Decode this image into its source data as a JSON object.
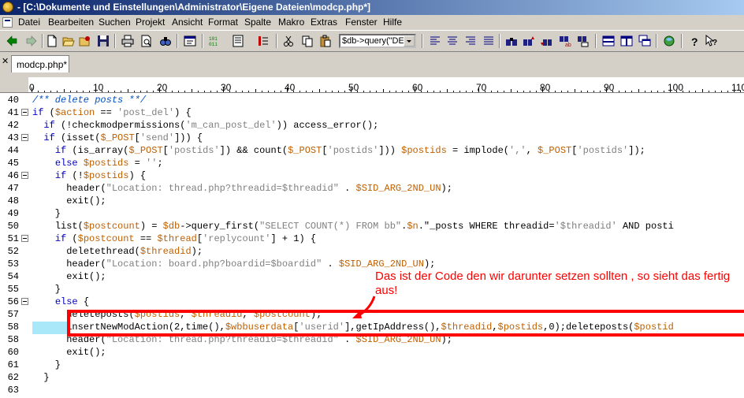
{
  "window": {
    "title": "- [C:\\Dokumente und Einstellungen\\Administrator\\Eigene Dateien\\modcp.php*]"
  },
  "menu": [
    "Datei",
    "Bearbeiten",
    "Suchen",
    "Projekt",
    "Ansicht",
    "Format",
    "Spalte",
    "Makro",
    "Extras",
    "Fenster",
    "Hilfe"
  ],
  "toolbar": {
    "search_combo_value": "$db->query(\"DE"
  },
  "tabs": [
    {
      "label": "modcp.php*"
    }
  ],
  "ruler": {
    "labels": [
      "0",
      "10",
      "20",
      "30",
      "40",
      "50",
      "60",
      "70",
      "80",
      "90",
      "100",
      "110"
    ]
  },
  "editor": {
    "lines": [
      {
        "n": "40",
        "fold": false,
        "code": "/** delete posts **/"
      },
      {
        "n": "41",
        "fold": true,
        "code": "if ($action == 'post_del') {"
      },
      {
        "n": "42",
        "fold": false,
        "code": "  if (!checkmodpermissions('m_can_post_del')) access_error();"
      },
      {
        "n": "43",
        "fold": true,
        "code": "  if (isset($_POST['send'])) {"
      },
      {
        "n": "44",
        "fold": false,
        "code": "    if (is_array($_POST['postids']) && count($_POST['postids'])) $postids = implode(',', $_POST['postids']);"
      },
      {
        "n": "45",
        "fold": false,
        "code": "    else $postids = '';"
      },
      {
        "n": "46",
        "fold": true,
        "code": "    if (!$postids) {"
      },
      {
        "n": "47",
        "fold": false,
        "code": "      header(\"Location: thread.php?threadid=$threadid\" . $SID_ARG_2ND_UN);"
      },
      {
        "n": "48",
        "fold": false,
        "code": "      exit();"
      },
      {
        "n": "49",
        "fold": false,
        "code": "    }"
      },
      {
        "n": "50",
        "fold": false,
        "code": "    list($postcount) = $db->query_first(\"SELECT COUNT(*) FROM bb\".$n.\"_posts WHERE threadid='$threadid' AND posti"
      },
      {
        "n": "51",
        "fold": true,
        "code": "    if ($postcount == $thread['replycount'] + 1) {"
      },
      {
        "n": "52",
        "fold": false,
        "code": "      deletethread($threadid);"
      },
      {
        "n": "53",
        "fold": false,
        "code": "      header(\"Location: board.php?boardid=$boardid\" . $SID_ARG_2ND_UN);"
      },
      {
        "n": "54",
        "fold": false,
        "code": "      exit();"
      },
      {
        "n": "55",
        "fold": false,
        "code": "    }"
      },
      {
        "n": "56",
        "fold": true,
        "code": "    else {"
      },
      {
        "n": "57",
        "fold": false,
        "code": "      deleteposts($postids, $threadid, $postcount);"
      },
      {
        "n": "58",
        "fold": false,
        "code": "      insertNewModAction(2,time(),$wbbuserdata['userid'],getIpAddress(),$threadid,$postids,0);deleteposts($postid"
      },
      {
        "n": "58",
        "fold": false,
        "code": "      header(\"Location: thread.php?threadid=$threadid\" . $SID_ARG_2ND_UN);"
      },
      {
        "n": "60",
        "fold": false,
        "code": "      exit();"
      },
      {
        "n": "61",
        "fold": false,
        "code": "    }"
      },
      {
        "n": "62",
        "fold": false,
        "code": "  }"
      },
      {
        "n": "63",
        "fold": false,
        "code": ""
      }
    ]
  },
  "annotation": {
    "text": "Das ist der Code den wir darunter setzen sollten , so sieht das fertig aus!"
  },
  "colors": {
    "keyword": "#0000c0",
    "variable": "#c06000",
    "string": "#808080",
    "comment": "#0050c0",
    "annotation": "#ff0000",
    "highlight": "#a8e8f8"
  }
}
